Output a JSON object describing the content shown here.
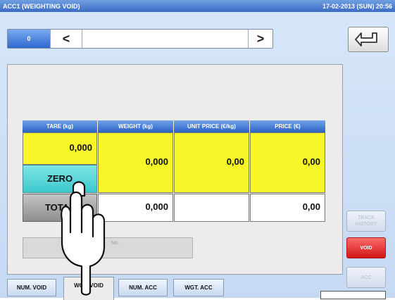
{
  "title_bar": {
    "screen_name": "ACC1 (WEIGHTING VOID)",
    "datetime": "17-02-2013 (SUN) 20:56"
  },
  "nav": {
    "counter": "0",
    "prev_label": "<",
    "next_label": ">",
    "back_icon": "return-arrow-icon"
  },
  "table": {
    "headers": [
      "TARE (kg)",
      "WEIGHT (kg)",
      "UNIT PRICE (€/kg)",
      "PRICE (€)"
    ],
    "tare_value": "0,000",
    "weight_value": "0,000",
    "unit_price_value": "0,00",
    "price_value": "0,00",
    "zero_label": "ZERO",
    "total_label": "TOTAL",
    "total_weight": "0,000",
    "total_unit_price": "",
    "total_price": "0,00"
  },
  "trace_field": {
    "label": "No."
  },
  "tabs": [
    "NUM. VOID",
    "WGT. VOID",
    "NUM. ACC",
    "WGT. ACC"
  ],
  "active_tab": "WGT. VOID",
  "side_buttons": {
    "trace_history": "TRACE HISTORY",
    "void": "VOID",
    "acc": "ACC"
  },
  "colors": {
    "header_blue": "#2d64c4",
    "entry_yellow": "#f6f629",
    "zero_cyan": "#3cc8cc",
    "void_red": "#d11515"
  }
}
